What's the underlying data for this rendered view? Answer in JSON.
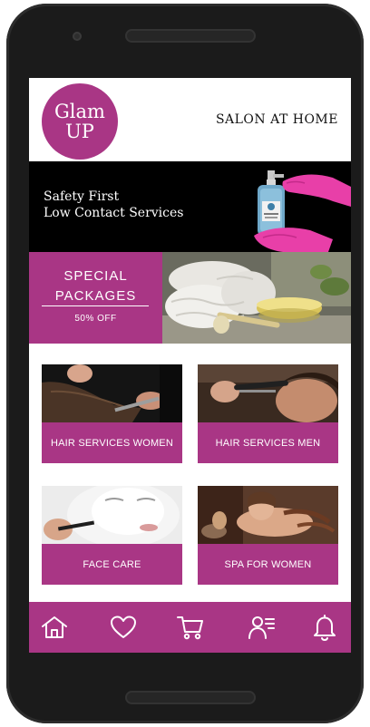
{
  "header": {
    "logo_line1": "Glam",
    "logo_line2": "UP",
    "title": "SALON AT HOME"
  },
  "banner": {
    "line1": "Safety First",
    "line2": "Low Contact Services"
  },
  "special": {
    "title_line1": "SPECIAL",
    "title_line2": "PACKAGES",
    "discount": "50% OFF"
  },
  "services": [
    {
      "label": "HAIR SERVICES WOMEN",
      "icon": "hair-women-image"
    },
    {
      "label": "HAIR SERVICES MEN",
      "icon": "hair-men-image"
    },
    {
      "label": "FACE CARE",
      "icon": "face-care-image"
    },
    {
      "label": "SPA FOR WOMEN",
      "icon": "spa-image"
    }
  ],
  "bottom_nav": {
    "items": [
      "home-icon",
      "heart-icon",
      "cart-icon",
      "profile-list-icon",
      "bell-icon"
    ]
  },
  "colors": {
    "brand": "#a93685",
    "banner_bg": "#000000",
    "glove": "#e83fa8"
  }
}
